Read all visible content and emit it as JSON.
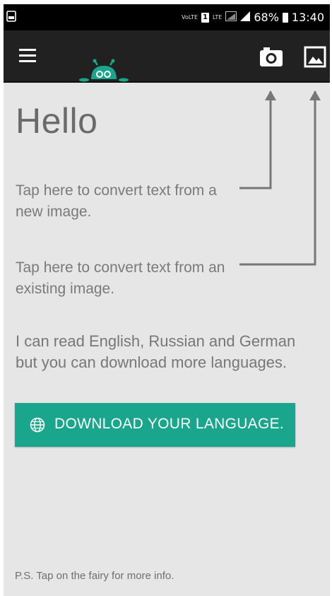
{
  "status_bar": {
    "volte": "VoLTE",
    "sim": "1",
    "lte": "LTE",
    "battery": "68%",
    "time": "13:40"
  },
  "app_bar": {
    "menu_icon": "hamburger-menu-icon",
    "logo_icon": "fairy-robot-icon",
    "camera_icon": "camera-icon",
    "gallery_icon": "image-icon",
    "background": "#212121"
  },
  "main": {
    "title": "Hello",
    "hint_new_image": "Tap here to convert text from a new image.",
    "hint_existing_image": "Tap here to convert text from an existing image.",
    "languages_text": "I can read English, Russian and German but you can download more languages.",
    "download_button": {
      "label": "DOWNLOAD YOUR LANGUAGE.",
      "icon": "globe-icon",
      "color": "#1aa68c"
    },
    "ps_text": "P.S. Tap on the fairy for more info."
  },
  "colors": {
    "background": "#e6e6e6",
    "accent": "#1aa68c",
    "text": "#6a6a6a"
  }
}
